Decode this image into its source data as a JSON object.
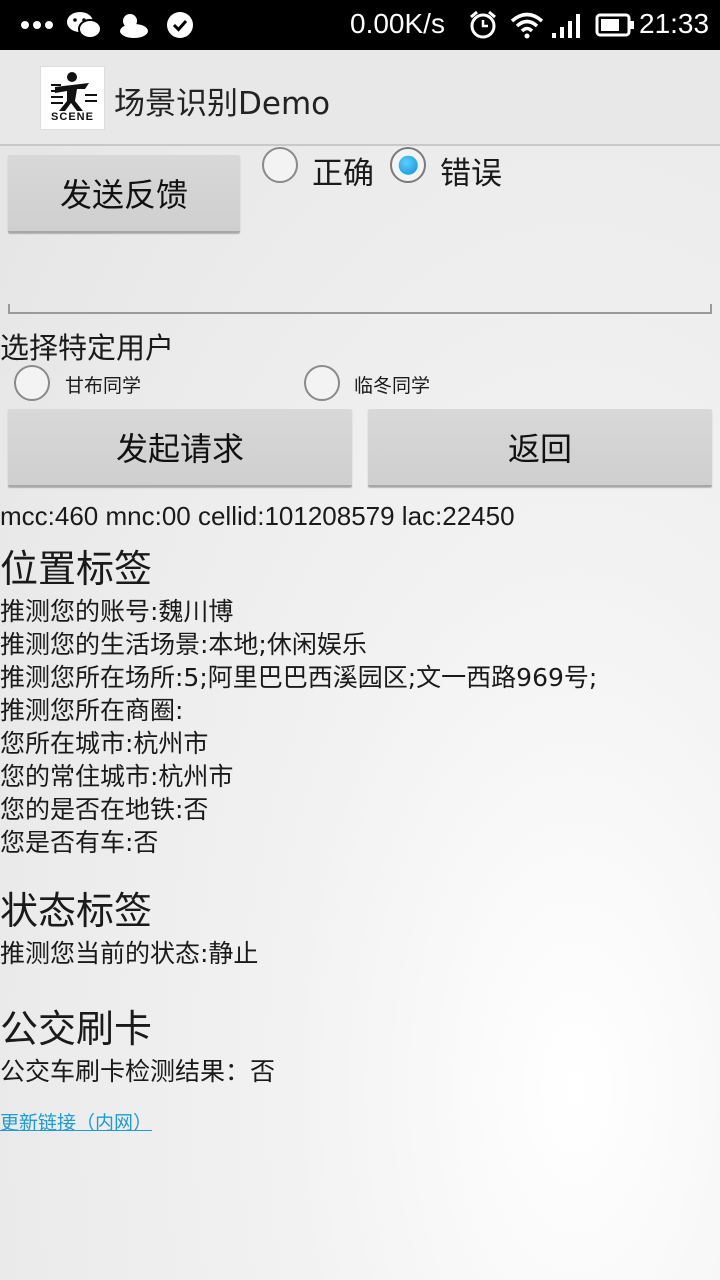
{
  "status_bar": {
    "speed": "0.00K/s",
    "time": "21:33",
    "icons": [
      "more-dots-icon",
      "wechat-icon",
      "weather-icon",
      "check-circle-icon",
      "alarm-icon",
      "wifi-icon",
      "signal-icon",
      "battery-icon"
    ]
  },
  "app": {
    "title": "场景识别Demo",
    "logo_text": "SCENE"
  },
  "feedback": {
    "send_label": "发送反馈",
    "options": [
      {
        "label": "正确",
        "checked": false
      },
      {
        "label": "错误",
        "checked": true
      }
    ]
  },
  "user_select": {
    "title": "选择特定用户",
    "options": [
      {
        "label": "甘布同学",
        "checked": false
      },
      {
        "label": "临冬同学",
        "checked": false
      }
    ]
  },
  "actions": {
    "request_label": "发起请求",
    "back_label": "返回"
  },
  "cell_info": "mcc:460  mnc:00 cellid:101208579  lac:22450",
  "location_section": {
    "title": "位置标签",
    "lines": [
      "推测您的账号:魏川博",
      "推测您的生活场景:本地;休闲娱乐",
      "推测您所在场所:5;阿里巴巴西溪园区;文一西路969号;",
      "推测您所在商圈:",
      "您所在城市:杭州市",
      "您的常住城市:杭州市",
      "您的是否在地铁:否",
      "您是否有车:否"
    ]
  },
  "state_section": {
    "title": "状态标签",
    "lines": [
      "推测您当前的状态:静止"
    ]
  },
  "bus_section": {
    "title": "公交刷卡",
    "lines": [
      "公交车刷卡检测结果：否"
    ]
  },
  "update_link": "更新链接（内网）",
  "colors": {
    "accent": "#0a8fd6",
    "link": "#1e9bd7"
  }
}
